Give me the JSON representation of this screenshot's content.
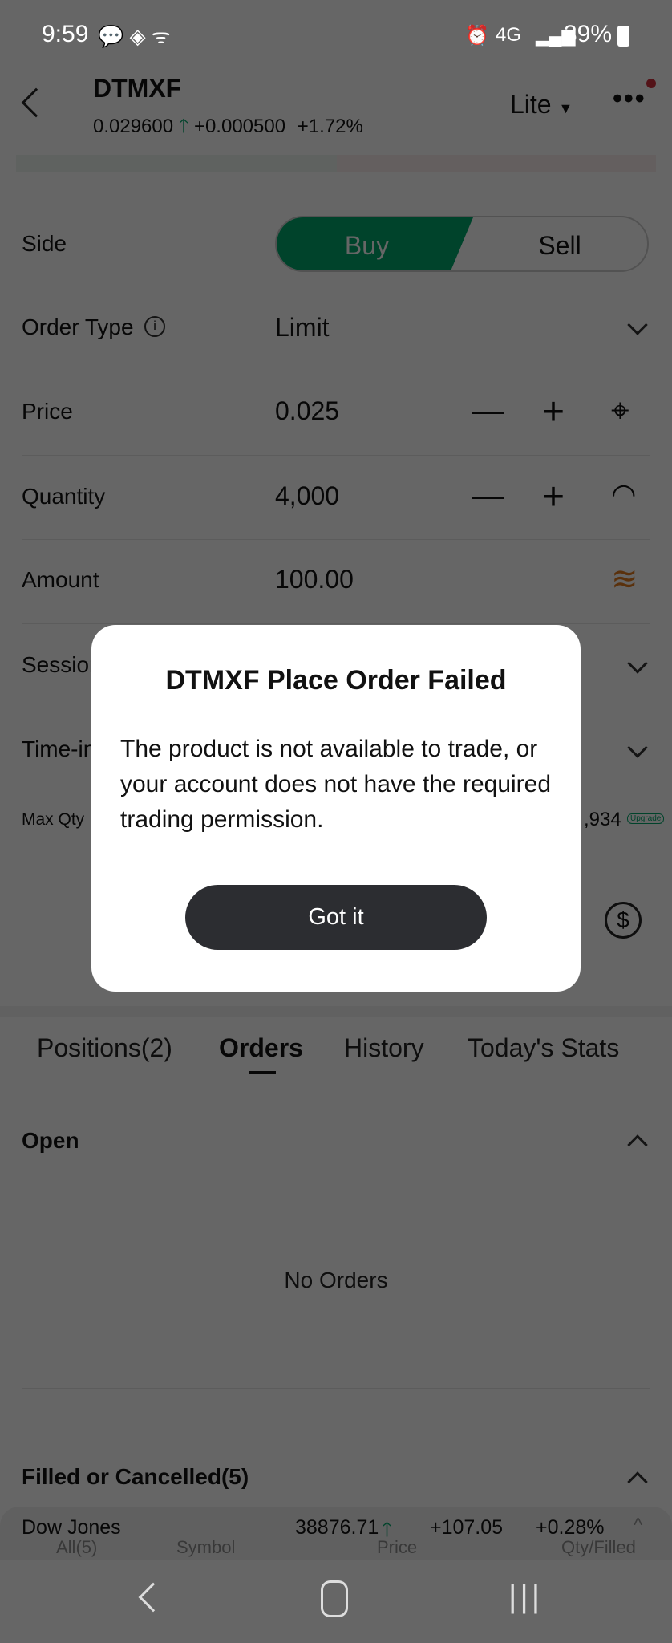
{
  "status_bar": {
    "time": "9:59",
    "network": "4G",
    "battery": "39%"
  },
  "header": {
    "symbol": "DTMXF",
    "price": "0.029600",
    "change": "+0.000500",
    "change_pct": "+1.72%",
    "mode": "Lite"
  },
  "form": {
    "side_label": "Side",
    "buy": "Buy",
    "sell": "Sell",
    "order_type_label": "Order Type",
    "order_type": "Limit",
    "price_label": "Price",
    "price": "0.025",
    "quantity_label": "Quantity",
    "quantity": "4,000",
    "amount_label": "Amount",
    "amount": "100.00",
    "session_label": "Session",
    "tif_label": "Time-in-Force",
    "max_qty_label": "Max Qty",
    "max_qty": ",934",
    "upgrade": "Upgrade"
  },
  "dialog": {
    "title": "DTMXF Place Order Failed",
    "message": "The product is not available to trade, or your account does not have the required trading permission.",
    "button": "Got it"
  },
  "tabs": [
    "Positions(2)",
    "Orders",
    "History",
    "Today's Stats"
  ],
  "orders": {
    "open_label": "Open",
    "empty": "No Orders",
    "filled_label": "Filled or Cancelled(5)",
    "columns": [
      "All(5)",
      "Symbol",
      "Price",
      "Qty/Filled"
    ]
  },
  "ticker": {
    "name": "Dow Jones",
    "value": "38876.71",
    "change": "+107.05",
    "change_pct": "+0.28%"
  },
  "colors": {
    "buy": "#00a86b",
    "up": "#00a86b",
    "accent": "#e07a1f",
    "sell": "#d0303c"
  }
}
